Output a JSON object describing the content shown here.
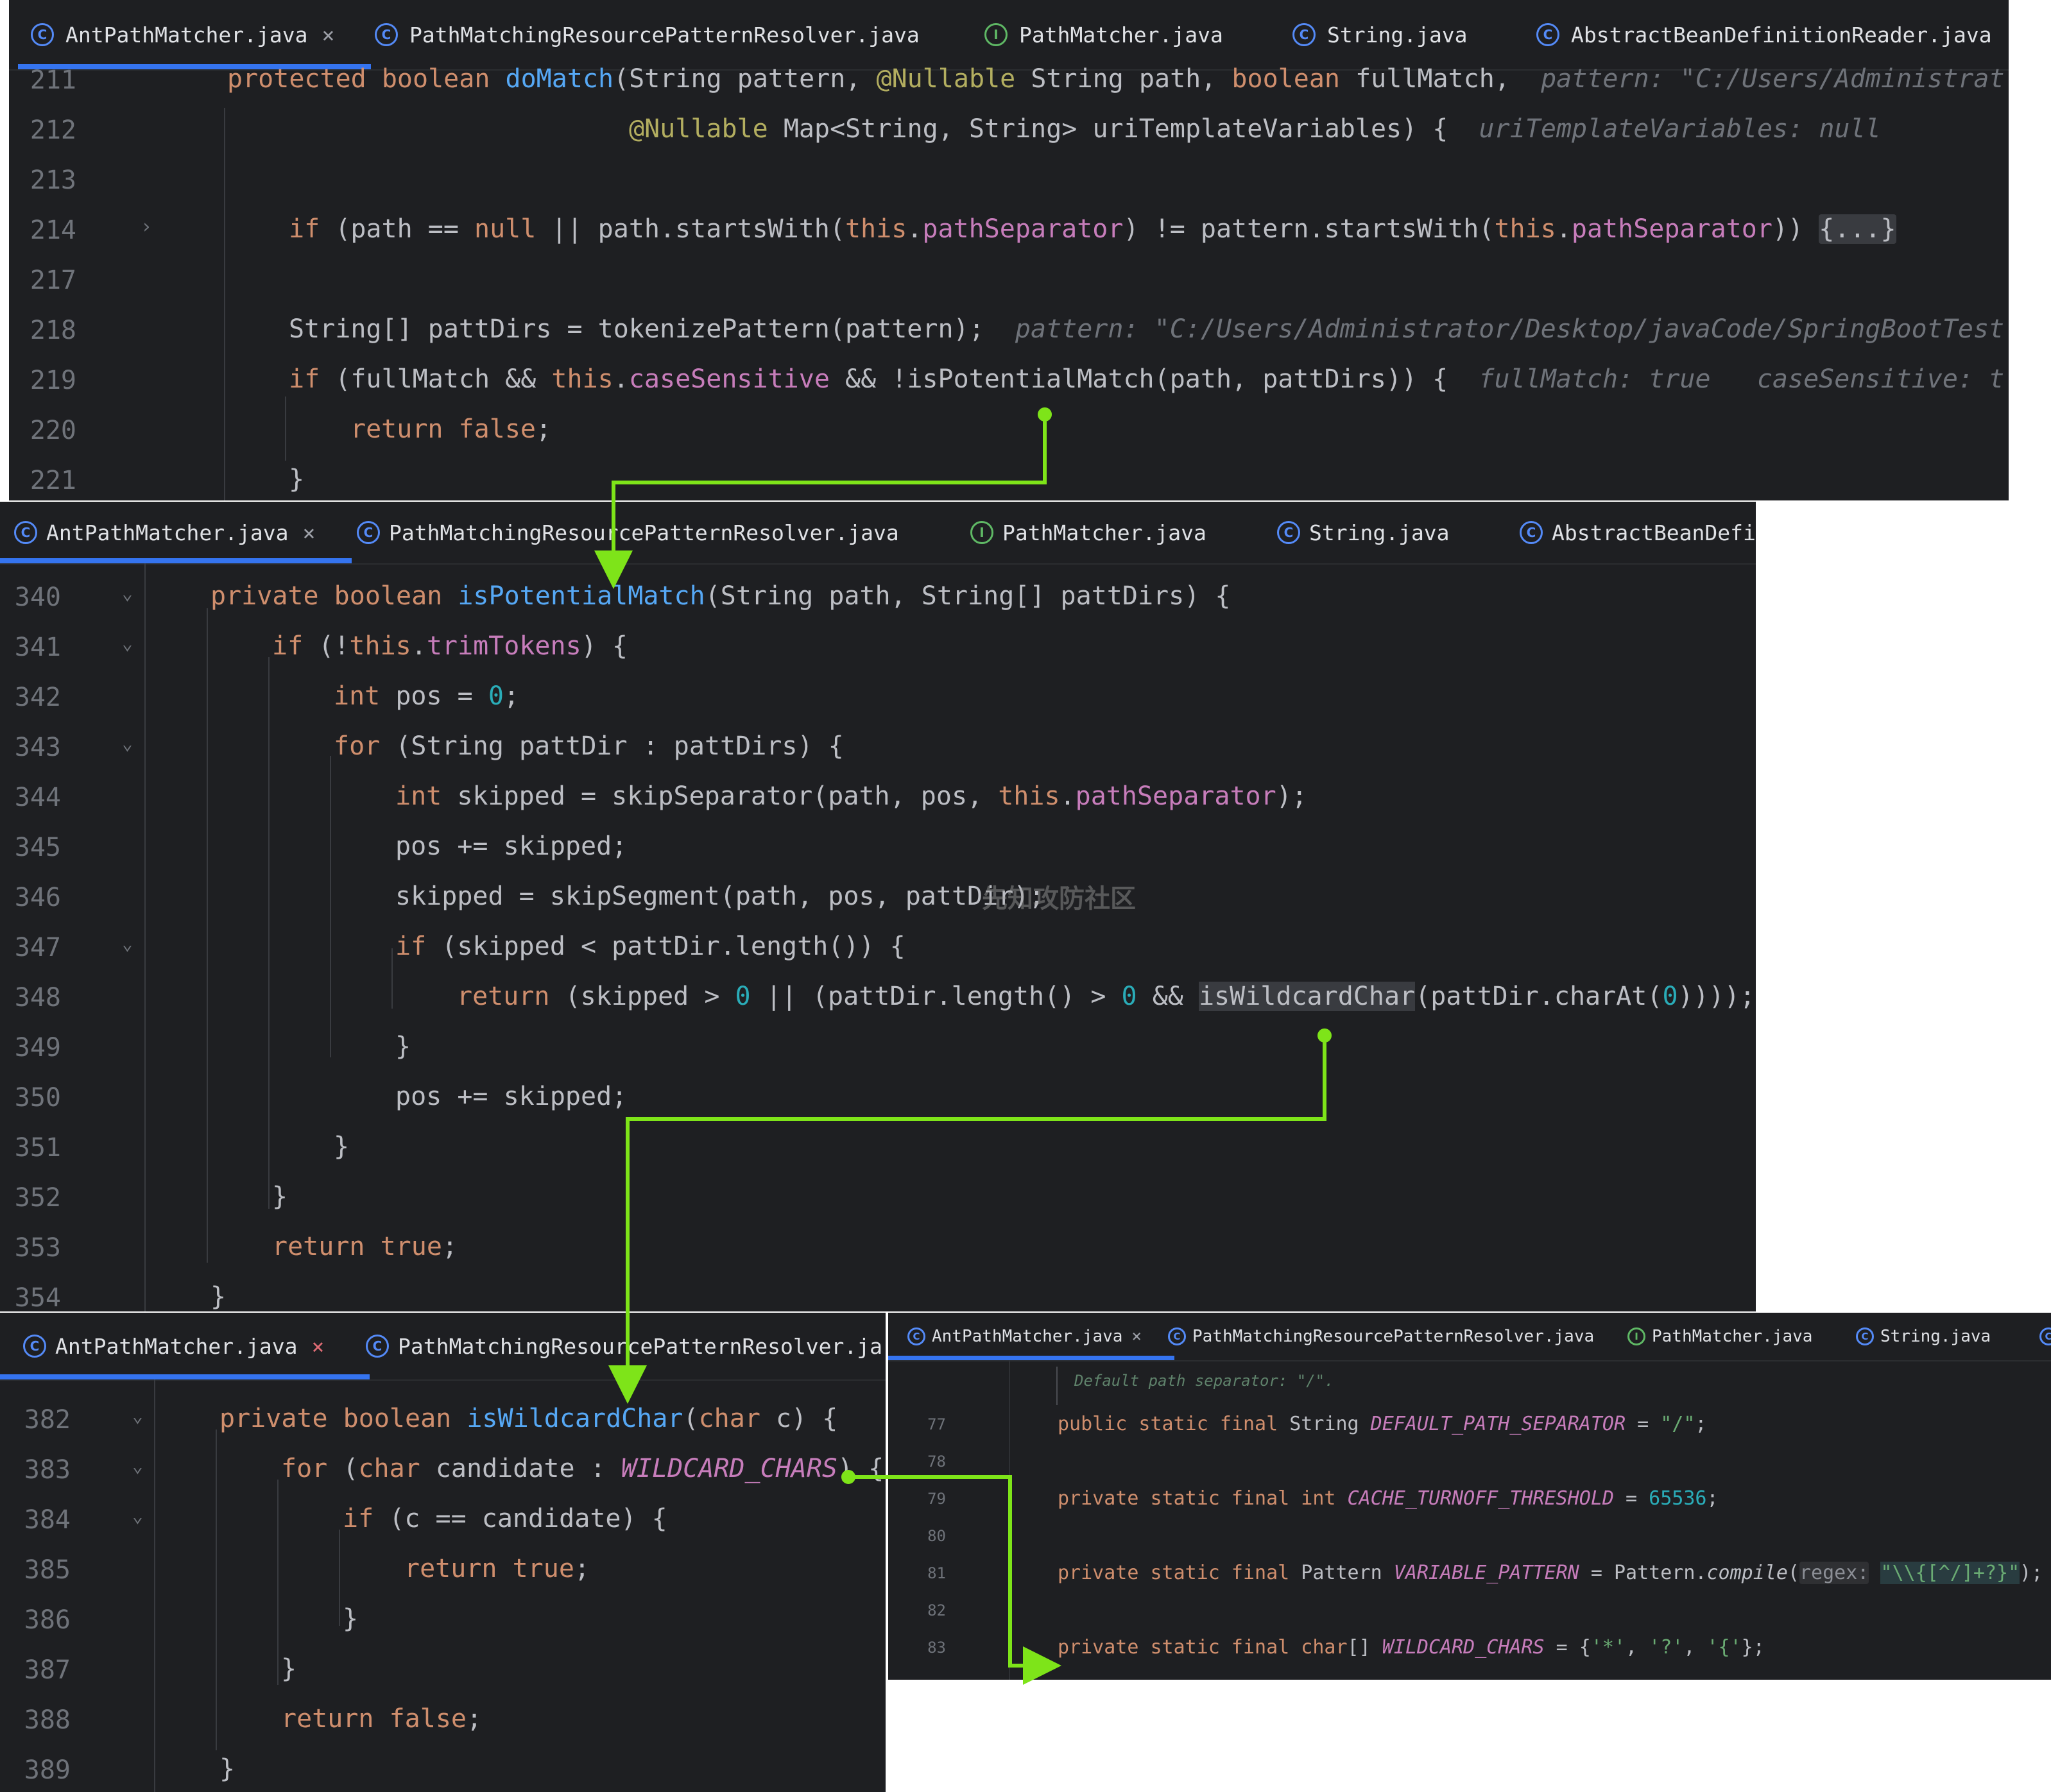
{
  "tabs_top": [
    "AntPathMatcher.java",
    "PathMatchingResourcePatternResolver.java",
    "PathMatcher.java",
    "String.java",
    "AbstractBeanDefinitionReader.java"
  ],
  "tabs_mid": [
    "AntPathMatcher.java",
    "PathMatchingResourcePatternResolver.java",
    "PathMatcher.java",
    "String.java",
    "AbstractBeanDefi"
  ],
  "tabs_bl": [
    "AntPathMatcher.java",
    "PathMatchingResourcePatternResolver.ja"
  ],
  "tabs_br": [
    "AntPathMatcher.java",
    "PathMatchingResourcePatternResolver.java",
    "PathMatcher.java",
    "String.java"
  ],
  "close_glyph": "×",
  "fold_glyph": "{...}",
  "watermark": "先知攻防社区",
  "p1": {
    "ln": [
      "211",
      "212",
      "213",
      "214",
      "217",
      "218",
      "219",
      "220",
      "221"
    ],
    "l1_kw1": "protected",
    "l1_kw2": "boolean",
    "l1_fn": "doMatch",
    "l1_a": "(String pattern, ",
    "l1_ann": "@Nullable",
    "l1_b": " String path, ",
    "l1_kw3": "boolean",
    "l1_c": " fullMatch,",
    "l1_hint": "pattern: \"C:/Users/Administrat",
    "l2_ann": "@Nullable",
    "l2_a": " Map<String, String> uriTemplateVariables) {",
    "l2_hint": "uriTemplateVariables: null",
    "l4_kw": "if",
    "l4_a": " (path == ",
    "l4_null": "null",
    "l4_b": " || path.startsWith(",
    "l4_this": "this",
    "l4_fld": "pathSeparator",
    "l4_c": ") != pattern.startsWith(",
    "l4_this2": "this",
    "l4_fld2": "pathSeparator",
    "l4_d": ")) ",
    "l6_a": "String[] pattDirs = tokenizePattern(pattern);",
    "l6_hint": "pattern: \"C:/Users/Administrator/Desktop/javaCode/SpringBootTest",
    "l7_kw": "if",
    "l7_a": " (fullMatch && ",
    "l7_this": "this",
    "l7_fld": "caseSensitive",
    "l7_b": " && !isPotentialMatch(path, pattDirs)) {",
    "l7_hint1": "fullMatch: true",
    "l7_hint2": "caseSensitive: t",
    "l8_kw": "return",
    "l8_kw2": "false",
    "l8_a": ";",
    "l9_a": "}"
  },
  "p2": {
    "ln": [
      "340",
      "341",
      "342",
      "343",
      "344",
      "345",
      "346",
      "347",
      "348",
      "349",
      "350",
      "351",
      "352",
      "353",
      "354"
    ],
    "l1_kw1": "private",
    "l1_kw2": "boolean",
    "l1_fn": "isPotentialMatch",
    "l1_a": "(String path, String[] pattDirs) {",
    "l2_kw": "if",
    "l2_a": " (!",
    "l2_this": "this",
    "l2_fld": "trimTokens",
    "l2_b": ") {",
    "l3_kw": "int",
    "l3_a": " pos = ",
    "l3_num": "0",
    "l3_b": ";",
    "l4_kw": "for",
    "l4_a": " (String pattDir : pattDirs) {",
    "l5_kw": "int",
    "l5_a": " skipped = skipSeparator(path, pos, ",
    "l5_this": "this",
    "l5_fld": "pathSeparator",
    "l5_b": ");",
    "l6_a": "pos += skipped;",
    "l7_a": "skipped = skipSegment(path, pos, pattDir);",
    "l8_kw": "if",
    "l8_a": " (skipped < pattDir.length()) {",
    "l9_kw": "return",
    "l9_a": " (skipped > ",
    "l9_n1": "0",
    "l9_b": " || (pattDir.length() > ",
    "l9_n2": "0",
    "l9_c": " && ",
    "l9_hl": "isWildcardChar",
    "l9_d": "(pattDir.charAt(",
    "l9_n3": "0",
    "l9_e": "))));",
    "l10_a": "}",
    "l11_a": "pos += skipped;",
    "l12_a": "}",
    "l13_a": "}",
    "l14_kw": "return",
    "l14_kw2": "true",
    "l14_a": ";",
    "l15_a": "}"
  },
  "p3": {
    "ln": [
      "382",
      "383",
      "384",
      "385",
      "386",
      "387",
      "388",
      "389"
    ],
    "l1_kw1": "private",
    "l1_kw2": "boolean",
    "l1_fn": "isWildcardChar",
    "l1_a": "(",
    "l1_kw3": "char",
    "l1_b": " c) {",
    "l2_kw": "for",
    "l2_a": " (",
    "l2_kw2": "char",
    "l2_b": " candidate : ",
    "l2_const": "WILDCARD_CHARS",
    "l2_c": ") {",
    "l3_kw": "if",
    "l3_a": " (c == candidate) {",
    "l4_kw": "return",
    "l4_kw2": "true",
    "l4_a": ";",
    "l5_a": "}",
    "l6_a": "}",
    "l7_kw": "return",
    "l7_kw2": "false",
    "l7_a": ";",
    "l8_a": "}"
  },
  "p4": {
    "ln": [
      "77",
      "78",
      "79",
      "80",
      "81",
      "82",
      "83"
    ],
    "doc": "Default path separator: \"/\".",
    "l1_kw": "public static final",
    "l1_a": " String ",
    "l1_const": "DEFAULT_PATH_SEPARATOR",
    "l1_b": " = ",
    "l1_str": "\"/\"",
    "l1_c": ";",
    "l3_kw": "private static final int",
    "l3_const": "CACHE_TURNOFF_THRESHOLD",
    "l3_b": " = ",
    "l3_num": "65536",
    "l3_c": ";",
    "l5_kw": "private static final",
    "l5_a": " Pattern ",
    "l5_const": "VARIABLE_PATTERN",
    "l5_b": " = Pattern.",
    "l5_fn": "compile",
    "l5_c": "(",
    "l5_hint": "regex:",
    "l5_str": "\"\\\\{[^/]+?}\"",
    "l5_d": ");",
    "l7_kw": "private static final char",
    "l7_a": "[] ",
    "l7_const": "WILDCARD_CHARS",
    "l7_b": " = {",
    "l7_s1": "'*'",
    "l7_c1": ", ",
    "l7_s2": "'?'",
    "l7_c2": ", ",
    "l7_s3": "'{'",
    "l7_d": "};"
  },
  "colors": {
    "arrow": "#7ee419",
    "bg": "#1e1f22",
    "accent": "#3574f0"
  }
}
